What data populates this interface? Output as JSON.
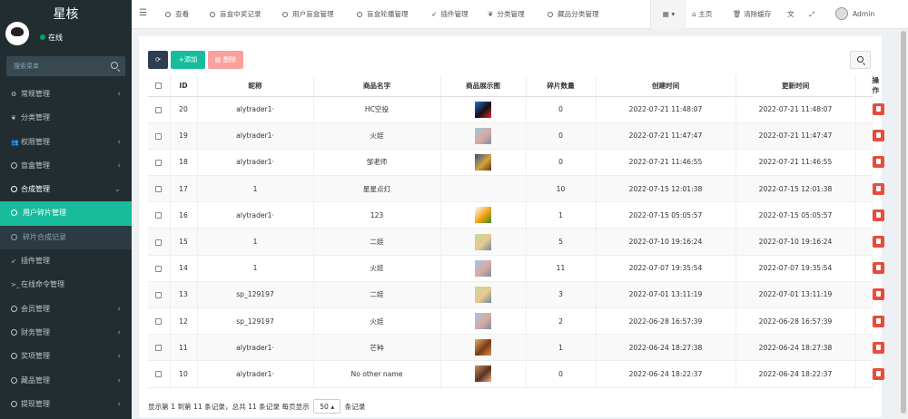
{
  "app": {
    "brand": "星核",
    "online": "在线"
  },
  "search": {
    "placeholder": "搜索菜单"
  },
  "sidebar": {
    "items": [
      {
        "label": "常规管理",
        "icon": "cogs-icon",
        "glyph": "⚙",
        "arrow": "‹"
      },
      {
        "label": "分类管理",
        "icon": "leaf-icon",
        "glyph": "❦",
        "arrow": ""
      },
      {
        "label": "权限管理",
        "icon": "users-icon",
        "glyph": "👥",
        "arrow": "‹"
      },
      {
        "label": "盲盒管理",
        "icon": "circle-icon",
        "glyph": "",
        "arrow": "‹"
      },
      {
        "label": "合成管理",
        "icon": "circle-icon",
        "glyph": "",
        "arrow": "⌄"
      },
      {
        "label": "用户碎片管理",
        "icon": "circle-icon",
        "glyph": "",
        "arrow": ""
      },
      {
        "label": "碎片合成记录",
        "icon": "circle-icon",
        "glyph": "",
        "arrow": ""
      },
      {
        "label": "插件管理",
        "icon": "rocket-icon",
        "glyph": "➶",
        "arrow": ""
      },
      {
        "label": "在线命令管理",
        "icon": "terminal-icon",
        "glyph": ">_",
        "arrow": ""
      },
      {
        "label": "会员管理",
        "icon": "circle-icon",
        "glyph": "",
        "arrow": "‹"
      },
      {
        "label": "财务管理",
        "icon": "circle-icon",
        "glyph": "",
        "arrow": "‹"
      },
      {
        "label": "奖项管理",
        "icon": "circle-icon",
        "glyph": "",
        "arrow": "‹"
      },
      {
        "label": "藏品管理",
        "icon": "circle-icon",
        "glyph": "",
        "arrow": "‹"
      },
      {
        "label": "提现管理",
        "icon": "circle-icon",
        "glyph": "",
        "arrow": "‹"
      }
    ]
  },
  "navbar": {
    "tabs": [
      "查看",
      "盲盒中奖记录",
      "用户盲盒管理",
      "盲盒轮播管理",
      "插件管理",
      "分类管理",
      "藏品分类管理"
    ],
    "home": "主页",
    "clear_cache": "清除缓存",
    "user": "Admin"
  },
  "toolbar": {
    "add": "添加",
    "delete": "删除"
  },
  "table": {
    "headers": [
      "ID",
      "昵称",
      "商品名字",
      "商品展示图",
      "碎片数量",
      "创建时间",
      "更新时间",
      "操作"
    ],
    "rows": [
      {
        "id": "20",
        "nickname": "alytrader1·",
        "name": "HC空投",
        "qty": "0",
        "created": "2022-07-21 11:48:07",
        "updated": "2022-07-21 11:48:07",
        "img": [
          "#2a6fd6",
          "#111",
          "#e23"
        ]
      },
      {
        "id": "19",
        "nickname": "alytrader1·",
        "name": "火娃",
        "qty": "0",
        "created": "2022-07-21 11:47:47",
        "updated": "2022-07-21 11:47:47",
        "img": [
          "#9ec8e8",
          "#d9a9a0",
          "#7c8fa8"
        ]
      },
      {
        "id": "18",
        "nickname": "alytrader1·",
        "name": "邹老师",
        "qty": "0",
        "created": "2022-07-21 11:46:55",
        "updated": "2022-07-21 11:46:55",
        "img": [
          "#2d4d8a",
          "#d8a23a",
          "#5a3a20"
        ]
      },
      {
        "id": "17",
        "nickname": "1",
        "name": "星星点灯",
        "qty": "10",
        "created": "2022-07-15 12:01:38",
        "updated": "2022-07-15 12:01:38",
        "img": null
      },
      {
        "id": "16",
        "nickname": "alytrader1·",
        "name": "123",
        "qty": "1",
        "created": "2022-07-15 05:05:57",
        "updated": "2022-07-15 05:05:57",
        "img": [
          "#ffffff",
          "#f4a010",
          "#3a8a2a"
        ]
      },
      {
        "id": "15",
        "nickname": "1",
        "name": "二娃",
        "qty": "5",
        "created": "2022-07-10 19:16:24",
        "updated": "2022-07-10 19:16:24",
        "img": [
          "#c8d8a0",
          "#e8c890",
          "#6a8a9a"
        ]
      },
      {
        "id": "14",
        "nickname": "1",
        "name": "火娃",
        "qty": "11",
        "created": "2022-07-07 19:35:54",
        "updated": "2022-07-07 19:35:54",
        "img": [
          "#9ec8e8",
          "#d9a9a0",
          "#7c8fa8"
        ]
      },
      {
        "id": "13",
        "nickname": "sp_129197",
        "name": "二娃",
        "qty": "3",
        "created": "2022-07-01 13:11:19",
        "updated": "2022-07-01 13:11:19",
        "img": [
          "#c8d8a0",
          "#e8c890",
          "#6a8a9a"
        ]
      },
      {
        "id": "12",
        "nickname": "sp_129197",
        "name": "火娃",
        "qty": "2",
        "created": "2022-06-28 16:57:39",
        "updated": "2022-06-28 16:57:39",
        "img": [
          "#9ec8e8",
          "#d9a9a0",
          "#7c8fa8"
        ]
      },
      {
        "id": "11",
        "nickname": "alytrader1·",
        "name": "芒种",
        "qty": "1",
        "created": "2022-06-24 18:27:38",
        "updated": "2022-06-24 18:27:38",
        "img": [
          "#e0b060",
          "#7a3a18",
          "#d89040"
        ]
      },
      {
        "id": "10",
        "nickname": "alytrader1·",
        "name": "No other name",
        "qty": "0",
        "created": "2022-06-24 18:22:37",
        "updated": "2022-06-24 18:22:37",
        "img": [
          "#c89060",
          "#5a3020",
          "#e8b880"
        ]
      }
    ]
  },
  "pager": {
    "text_before": "显示第 1 到第 11 条记录，总共 11 条记录 每页显示",
    "per_page": "50",
    "text_after": "条记录"
  },
  "colors": {
    "sidebar": "#222d32",
    "accent": "#18bc9c",
    "danger": "#e74c3c",
    "dark": "#2c3e50"
  }
}
